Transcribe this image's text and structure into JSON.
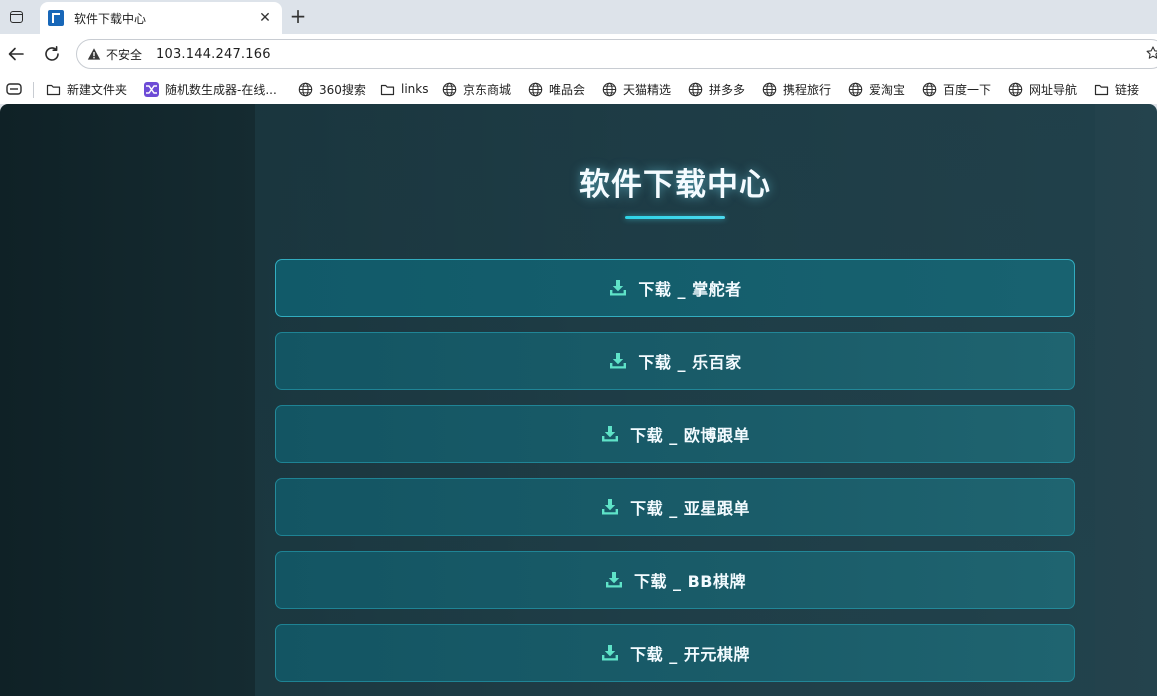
{
  "browser": {
    "tab": {
      "title": "软件下载中心",
      "close": "✕"
    },
    "new_tab": "+",
    "omnibox": {
      "security_label": "不安全",
      "url": "103.144.247.166"
    },
    "bookmarks": [
      {
        "label": "新建文件夹",
        "icon": "folder-icon"
      },
      {
        "label": "随机数生成器-在线...",
        "icon": "shuffle-icon"
      },
      {
        "label": "360搜索",
        "icon": "globe-icon"
      },
      {
        "label": "links",
        "icon": "folder-icon"
      },
      {
        "label": "京东商城",
        "icon": "globe-icon"
      },
      {
        "label": "唯品会",
        "icon": "globe-icon"
      },
      {
        "label": "天猫精选",
        "icon": "globe-icon"
      },
      {
        "label": "拼多多",
        "icon": "globe-icon"
      },
      {
        "label": "携程旅行",
        "icon": "globe-icon"
      },
      {
        "label": "爱淘宝",
        "icon": "globe-icon"
      },
      {
        "label": "百度一下",
        "icon": "globe-icon"
      },
      {
        "label": "网址导航",
        "icon": "globe-icon"
      },
      {
        "label": "链接",
        "icon": "folder-icon"
      }
    ]
  },
  "page": {
    "title": "软件下载中心",
    "downloads": [
      {
        "label": "下载 _ 掌舵者"
      },
      {
        "label": "下载 _ 乐百家"
      },
      {
        "label": "下载 _ 欧博跟单"
      },
      {
        "label": "下载 _ 亚星跟单"
      },
      {
        "label": "下载 _ BB棋牌"
      },
      {
        "label": "下载 _ 开元棋牌"
      }
    ]
  },
  "colors": {
    "accent": "#2ed3e6",
    "download_icon": "#5fe3c8",
    "page_bg": "#152b31",
    "button_bg": "#1a5c69"
  }
}
